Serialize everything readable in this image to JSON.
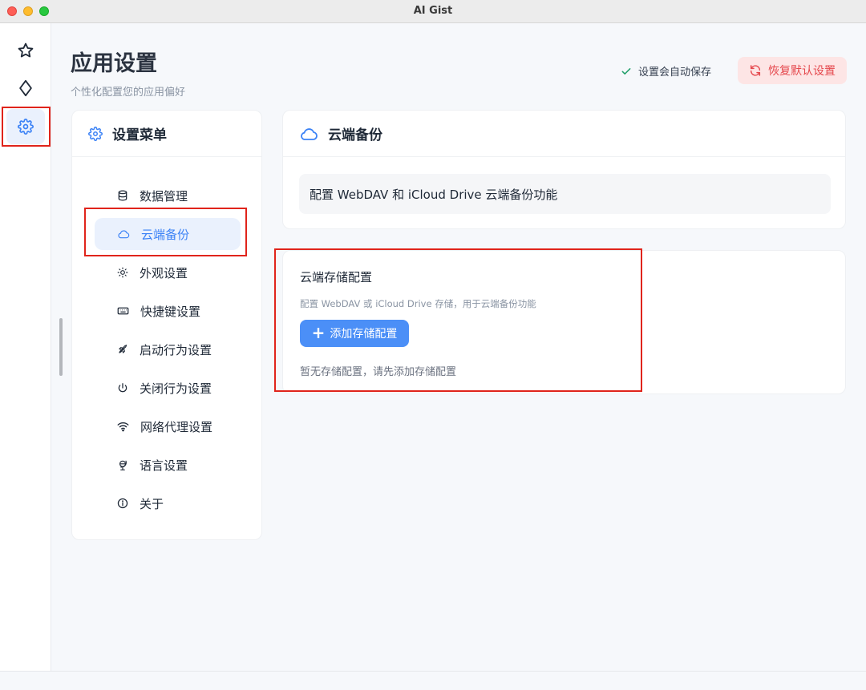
{
  "window": {
    "title": "AI Gist"
  },
  "rail": {
    "items": [
      {
        "icon": "star-icon",
        "active": false
      },
      {
        "icon": "diamond-icon",
        "active": false
      },
      {
        "icon": "gear-icon",
        "active": true
      }
    ]
  },
  "header": {
    "title": "应用设置",
    "subtitle": "个性化配置您的应用偏好",
    "autosave_text": "设置会自动保存",
    "reset_label": "恢复默认设置"
  },
  "menu": {
    "title": "设置菜单",
    "items": [
      {
        "label": "数据管理",
        "icon": "database-icon"
      },
      {
        "label": "云端备份",
        "icon": "cloud-icon",
        "active": true
      },
      {
        "label": "外观设置",
        "icon": "sun-icon"
      },
      {
        "label": "快捷键设置",
        "icon": "keyboard-icon"
      },
      {
        "label": "启动行为设置",
        "icon": "rocket-icon"
      },
      {
        "label": "关闭行为设置",
        "icon": "power-icon"
      },
      {
        "label": "网络代理设置",
        "icon": "wifi-icon"
      },
      {
        "label": "语言设置",
        "icon": "globe-icon"
      },
      {
        "label": "关于",
        "icon": "info-icon"
      }
    ]
  },
  "section": {
    "title": "云端备份",
    "description": "配置 WebDAV 和 iCloud Drive 云端备份功能"
  },
  "storage": {
    "title": "云端存储配置",
    "subtitle": "配置 WebDAV 或 iCloud Drive 存储，用于云端备份功能",
    "add_label": "添加存储配置",
    "empty_text": "暂无存储配置，请先添加存储配置"
  },
  "colors": {
    "accent": "#3b82f6",
    "danger": "#e5484d",
    "success": "#22a06b",
    "highlight": "#e0241b"
  }
}
